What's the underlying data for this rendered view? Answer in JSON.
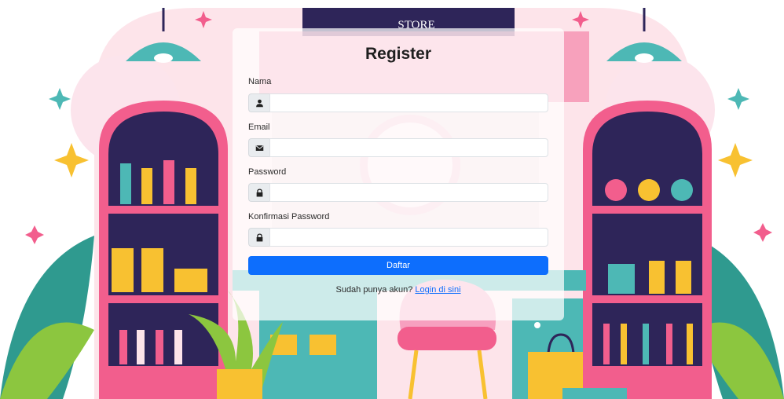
{
  "form": {
    "title": "Register",
    "fields": [
      {
        "label": "Nama",
        "icon": "user-icon",
        "value": "",
        "type": "text"
      },
      {
        "label": "Email",
        "icon": "envelope-icon",
        "value": "",
        "type": "email"
      },
      {
        "label": "Password",
        "icon": "lock-icon",
        "value": "",
        "type": "password"
      },
      {
        "label": "Konfirmasi Password",
        "icon": "lock-icon",
        "value": "",
        "type": "password"
      }
    ],
    "submit_label": "Daftar",
    "footer_text": "Sudah punya akun?",
    "login_link": "Login di sini"
  },
  "background": {
    "sign_text": "STORE",
    "colors": {
      "pink": "#f25e8d",
      "navy": "#2e2559",
      "teal": "#4db8b5",
      "yellow": "#f8c131",
      "accent": "#0d6efd"
    }
  }
}
